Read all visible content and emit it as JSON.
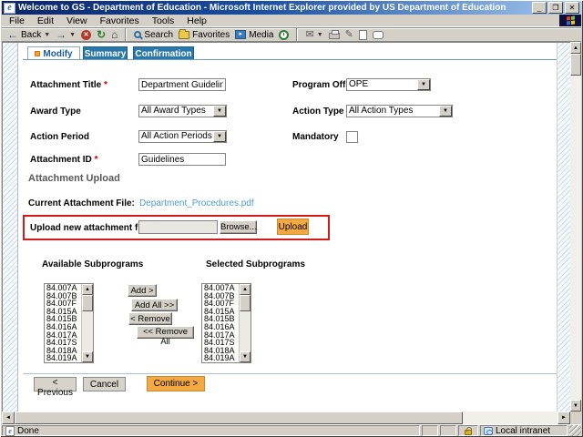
{
  "window": {
    "title": "Welcome to GS - Department of Education - Microsoft Internet Explorer provided by US Department of Education",
    "menu": [
      "File",
      "Edit",
      "View",
      "Favorites",
      "Tools",
      "Help"
    ],
    "toolbar": {
      "back": "Back",
      "search": "Search",
      "favorites": "Favorites",
      "media": "Media"
    },
    "statusbar": {
      "status": "Done",
      "zone": "Local intranet"
    }
  },
  "tabs": {
    "modify": "Modify",
    "summary": "Summary",
    "confirmation": "Confirmation"
  },
  "form": {
    "attachment_title": {
      "label": "Attachment Title",
      "required": "*",
      "value": "Department Guidelines"
    },
    "program_office": {
      "label": "Program Office",
      "value": "OPE"
    },
    "award_type": {
      "label": "Award Type",
      "value": "All Award Types"
    },
    "action_type": {
      "label": "Action Type",
      "value": "All Action Types"
    },
    "action_period": {
      "label": "Action Period",
      "value": "All Action Periods"
    },
    "mandatory": {
      "label": "Mandatory",
      "checked": false
    },
    "attachment_id": {
      "label": "Attachment ID",
      "required": "*",
      "value": "Guidelines"
    }
  },
  "upload": {
    "heading": "Attachment Upload",
    "current_label": "Current Attachment File:",
    "current_file": "Department_Procedures.pdf",
    "new_label": "Upload new attachment file",
    "required": "*",
    "browse": "Browse...",
    "upload": "Upload"
  },
  "subprograms": {
    "available_label": "Available Subprograms",
    "selected_label": "Selected Subprograms",
    "available": [
      "84.007A",
      "84.007B",
      "84.007F",
      "84.015A",
      "84.015B",
      "84.016A",
      "84.017A",
      "84.017S",
      "84.018A",
      "84.019A"
    ],
    "selected": [
      "84.007A",
      "84.007B",
      "84.007F",
      "84.015A",
      "84.015B",
      "84.016A",
      "84.017A",
      "84.017S",
      "84.018A",
      "84.019A"
    ],
    "add": "Add >",
    "add_all": "Add All >>",
    "remove": "< Remove",
    "remove_all": "<< Remove All"
  },
  "footer": {
    "previous": "< Previous",
    "cancel": "Cancel",
    "continue": "Continue >"
  },
  "colors": {
    "accent_orange": "#F4A841",
    "tab_blue": "#2878AB",
    "link_blue": "#4E9CCB",
    "highlight_red": "#D31A1A",
    "titlebar_start": "#0A246A",
    "titlebar_end": "#A6CAF0"
  }
}
